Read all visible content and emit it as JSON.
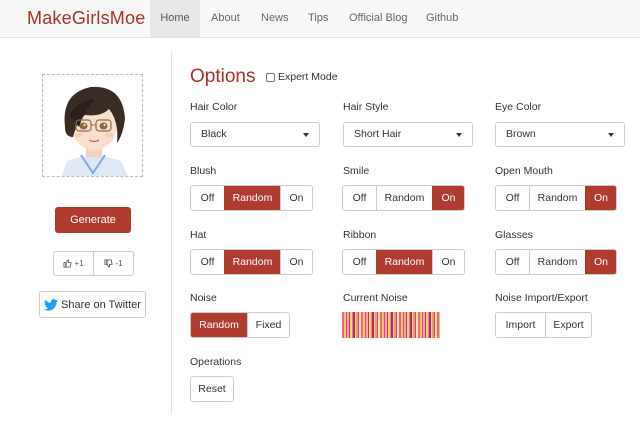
{
  "nav": {
    "brand": "MakeGirlsMoe",
    "items": [
      {
        "label": "Home",
        "active": true
      },
      {
        "label": "About",
        "active": false
      },
      {
        "label": "News",
        "active": false
      },
      {
        "label": "Tips",
        "active": false
      },
      {
        "label": "Official Blog",
        "active": false
      },
      {
        "label": "Github",
        "active": false
      }
    ]
  },
  "sidebar": {
    "generate_label": "Generate",
    "vote_up_label": "+1",
    "vote_down_label": "-1",
    "twitter_label": "Share on Twitter"
  },
  "options": {
    "title": "Options",
    "expert_mode_label": "Expert Mode",
    "expert_mode_checked": false,
    "hair_color": {
      "label": "Hair Color",
      "value": "Black"
    },
    "hair_style": {
      "label": "Hair Style",
      "value": "Short Hair"
    },
    "eye_color": {
      "label": "Eye Color",
      "value": "Brown"
    },
    "blush": {
      "label": "Blush",
      "options": [
        "Off",
        "Random",
        "On"
      ],
      "selected": "Random"
    },
    "smile": {
      "label": "Smile",
      "options": [
        "Off",
        "Random",
        "On"
      ],
      "selected": "On"
    },
    "open_mouth": {
      "label": "Open Mouth",
      "options": [
        "Off",
        "Random",
        "On"
      ],
      "selected": "On"
    },
    "hat": {
      "label": "Hat",
      "options": [
        "Off",
        "Random",
        "On"
      ],
      "selected": "Random"
    },
    "ribbon": {
      "label": "Ribbon",
      "options": [
        "Off",
        "Random",
        "On"
      ],
      "selected": "Random"
    },
    "glasses": {
      "label": "Glasses",
      "options": [
        "Off",
        "Random",
        "On"
      ],
      "selected": "On"
    },
    "noise": {
      "label": "Noise",
      "options": [
        "Random",
        "Fixed"
      ],
      "selected": "Random"
    },
    "current_noise_label": "Current Noise",
    "noise_io": {
      "label": "Noise Import/Export",
      "import_label": "Import",
      "export_label": "Export"
    },
    "operations": {
      "label": "Operations",
      "reset_label": "Reset"
    }
  },
  "colors": {
    "accent": "#b03b2f",
    "brand": "#a83228"
  }
}
